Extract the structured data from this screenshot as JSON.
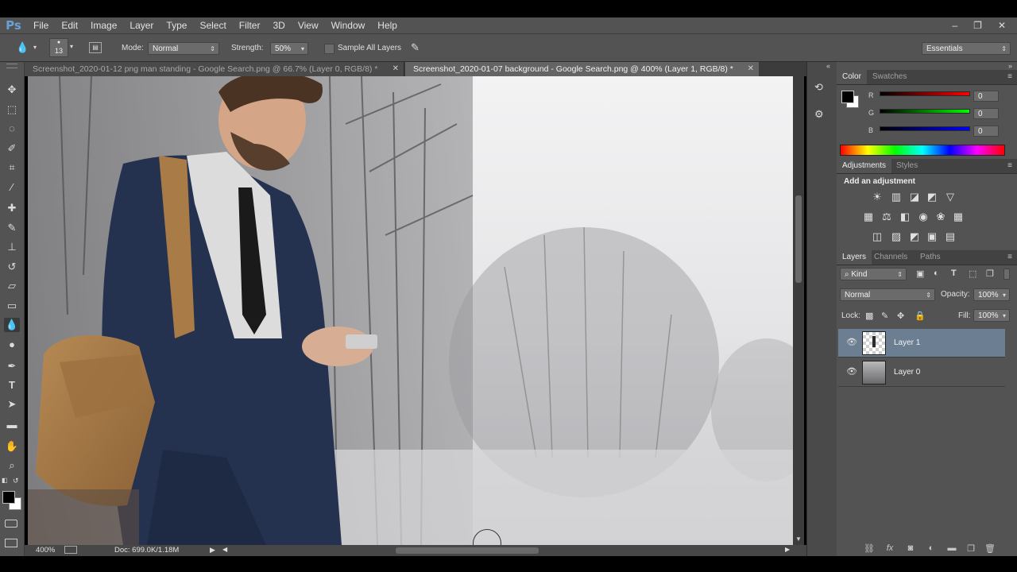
{
  "app": {
    "logo": "Ps"
  },
  "menu": {
    "items": [
      "File",
      "Edit",
      "Image",
      "Layer",
      "Type",
      "Select",
      "Filter",
      "3D",
      "View",
      "Window",
      "Help"
    ]
  },
  "window_controls": {
    "minimize": "–",
    "restore": "❐",
    "close": "✕"
  },
  "options_bar": {
    "brush_size": "13",
    "mode_label": "Mode:",
    "mode_value": "Normal",
    "strength_label": "Strength:",
    "strength_value": "50%",
    "sample_all_layers_label": "Sample All Layers",
    "sample_all_layers_checked": false,
    "workspace": "Essentials"
  },
  "tools": [
    "move-icon",
    "marquee-icon",
    "lasso-icon",
    "quick-select-icon",
    "crop-icon",
    "eyedropper-icon",
    "healing-brush-icon",
    "brush-icon",
    "clone-stamp-icon",
    "history-brush-icon",
    "eraser-icon",
    "gradient-icon",
    "blur-icon",
    "dodge-icon",
    "pen-icon",
    "type-icon",
    "path-select-icon",
    "rectangle-icon",
    "hand-icon",
    "zoom-icon"
  ],
  "document_tabs": [
    {
      "label": "Screenshot_2020-01-12 png man standing - Google Search.png @ 66.7% (Layer 0, RGB/8) *",
      "active": false
    },
    {
      "label": "Screenshot_2020-01-07 background - Google Search.png @ 400% (Layer 1, RGB/8) *",
      "active": true
    }
  ],
  "status_bar": {
    "zoom": "400%",
    "doc_info": "Doc: 699.0K/1.18M"
  },
  "color_panel": {
    "tabs": [
      "Color",
      "Swatches"
    ],
    "r_label": "R",
    "r_value": "0",
    "g_label": "G",
    "g_value": "0",
    "b_label": "B",
    "b_value": "0",
    "foreground": "#000000",
    "background": "#ffffff"
  },
  "adjustments_panel": {
    "tabs": [
      "Adjustments",
      "Styles"
    ],
    "heading": "Add an adjustment"
  },
  "layers_panel": {
    "tabs": [
      "Layers",
      "Channels",
      "Paths"
    ],
    "filter_value": "Kind",
    "blend_mode": "Normal",
    "opacity_label": "Opacity:",
    "opacity_value": "100%",
    "lock_label": "Lock:",
    "fill_label": "Fill:",
    "fill_value": "100%",
    "layers": [
      {
        "name": "Layer 1",
        "selected": true,
        "visible": true
      },
      {
        "name": "Layer 0",
        "selected": false,
        "visible": true
      }
    ]
  },
  "colors": {
    "ui_bg": "#535353",
    "panel_dark": "#424242",
    "selected_layer": "#6c7f92",
    "accent_blue": "#6aa0d8"
  }
}
